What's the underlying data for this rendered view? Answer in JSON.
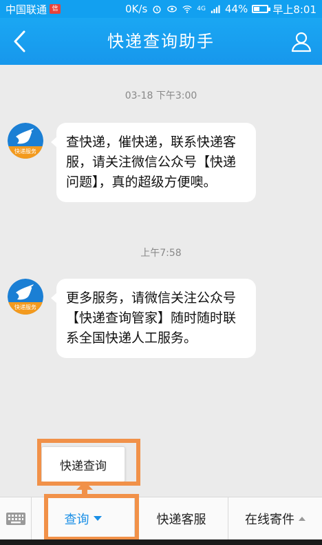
{
  "status_bar": {
    "carrier": "中国联通",
    "network_speed": "0K/s",
    "signal_label": "4G",
    "battery": "44%",
    "battery_level": 0.44,
    "time": "早上8:01"
  },
  "header": {
    "title": "快递查询助手",
    "back_icon": "chevron-left-icon",
    "profile_icon": "person-icon"
  },
  "messages": [
    {
      "timestamp": "03-18 下午3:00",
      "sender_badge": "快递服务",
      "text": "查快递，催快递，联系快递客服，请关注微信公众号【快递问题】，真的超级方便噢。"
    },
    {
      "timestamp": "上午7:58",
      "sender_badge": "快递服务",
      "text": "更多服务，请微信关注公众号【快递查询管家】随时随时联系全国快递人工服务。"
    }
  ],
  "popup_menu": {
    "items": [
      "快递查询"
    ]
  },
  "bottom_menu": {
    "keyboard_icon": "keyboard-icon",
    "items": [
      {
        "label": "查询",
        "indicator": "triangle-down-icon",
        "active": true
      },
      {
        "label": "快递客服"
      },
      {
        "label": "在线寄件",
        "indicator": "triangle-up-icon"
      }
    ]
  },
  "colors": {
    "header_blue": "#1797ec",
    "accent_blue": "#1a8fe6",
    "highlight_orange": "#f19149",
    "chat_bg": "#ebebeb"
  }
}
